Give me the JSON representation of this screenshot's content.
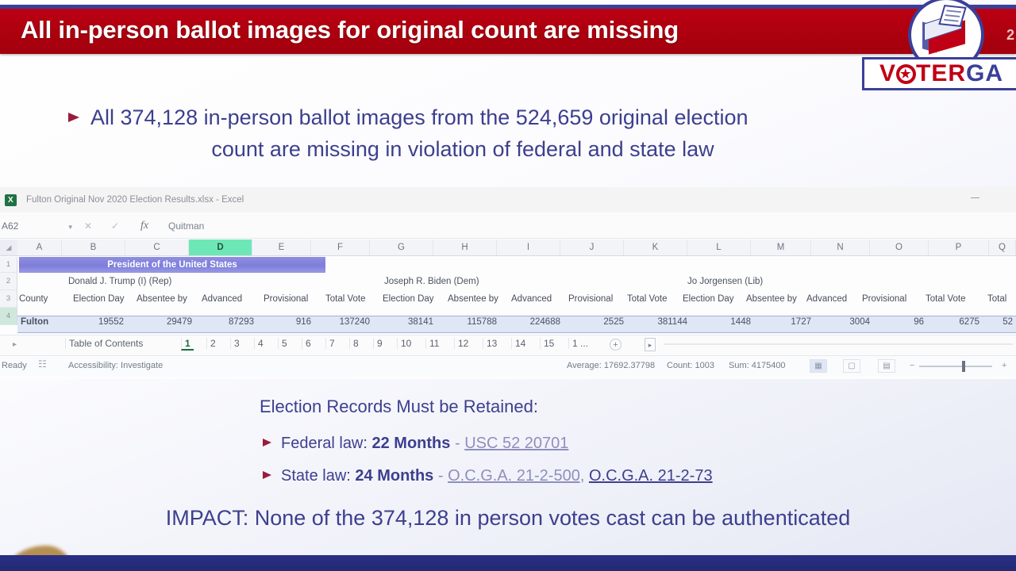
{
  "slide": {
    "title": "All in-person ballot images for original count are missing",
    "slide_number": "2",
    "headline_line1": "All 374,128 in-person ballot images from the 524,659 original election",
    "headline_line2": "count are missing in violation of federal and state law",
    "impact": "IMPACT: None of the 374,128 in person votes cast can be authenticated",
    "accent_red": "#c00014",
    "accent_blue": "#3b3f98",
    "text_purple": "#3d3f8e"
  },
  "logo": {
    "name_red": "V",
    "name_red_tail": "TER",
    "name_blue": "GA",
    "star": "★"
  },
  "retention": {
    "title": "Election Records Must be Retained:",
    "federal": {
      "label": "Federal law:",
      "duration": "22 Months",
      "dash": "-",
      "citation": "USC 52 20701"
    },
    "state": {
      "label": "State law:",
      "duration": "24 Months",
      "dash": "-",
      "citation_1": "O.C.G.A. 21-2-500,",
      "citation_2": "O.C.G.A. 21-2-73"
    }
  },
  "excel": {
    "window_title": "Fulton Original Nov 2020 Election Results.xlsx  -  Excel",
    "app_icon": "excel-icon",
    "name_box": "A62",
    "formula_value": "Quitman",
    "corner_glyph": "◢",
    "columns": [
      "A",
      "B",
      "C",
      "D",
      "E",
      "F",
      "G",
      "H",
      "I",
      "J",
      "K",
      "L",
      "M",
      "N",
      "O",
      "P",
      "Q"
    ],
    "selected_column": "D",
    "row_numbers": [
      "1",
      "2",
      "3",
      "4"
    ],
    "merged_header": "President of the United States",
    "candidates": [
      "Donald J. Trump (I) (Rep)",
      "Joseph R. Biden (Dem)",
      "Jo Jorgensen (Lib)"
    ],
    "sub_headers": [
      "County",
      "Election Day",
      "Absentee by",
      "Advanced",
      "Provisional",
      "Total Vote",
      "Election Day",
      "Absentee by",
      "Advanced",
      "Provisional",
      "Total Vote",
      "Election Day",
      "Absentee by",
      "Advanced",
      "Provisional",
      "Total Vote",
      "Total"
    ],
    "data_row": {
      "county": "Fulton",
      "values": [
        "19552",
        "29479",
        "87293",
        "916",
        "137240",
        "38141",
        "115788",
        "224688",
        "2525",
        "381144",
        "1448",
        "1727",
        "3004",
        "96",
        "6275",
        "52"
      ]
    },
    "sheet_tabs": [
      "Table of Contents",
      "1",
      "2",
      "3",
      "4",
      "5",
      "6",
      "7",
      "8",
      "9",
      "10",
      "11",
      "12",
      "13",
      "14",
      "15",
      "1 ..."
    ],
    "active_sheet": "1",
    "add_sheet_label": "+",
    "scroll_right_label": "▸",
    "nav_arrow": "▸",
    "status": {
      "ready": "Ready",
      "accessibility": "Accessibility: Investigate",
      "average": "Average: 17692.37798",
      "count": "Count: 1003",
      "sum": "Sum: 4175400"
    },
    "view_buttons": [
      "normal-view",
      "page-layout-view",
      "page-break-view"
    ],
    "zoom_minus": "−",
    "zoom_plus": "+"
  }
}
